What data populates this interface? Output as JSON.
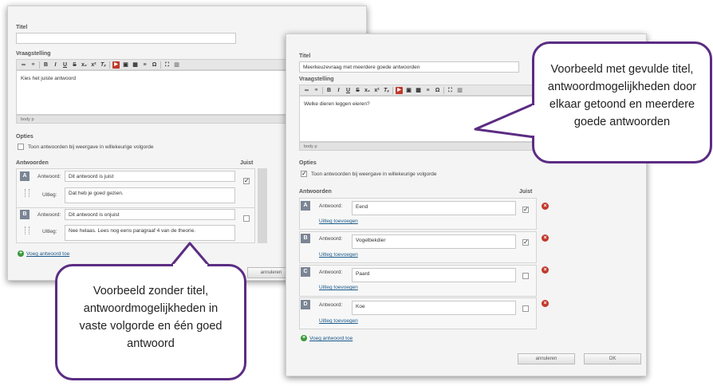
{
  "left": {
    "title_label": "Titel",
    "title_value": "",
    "question_label": "Vraagstelling",
    "question_text": "Kies het juiste antwoord",
    "editor_footer": "body  p",
    "options_label": "Opties",
    "shuffle_label": "Toon antwoorden bij weergave in willekeurige volgorde",
    "shuffle_checked": false,
    "answers_label": "Antwoorden",
    "correct_label": "Juist",
    "answer_field_label": "Antwoord:",
    "explanation_field_label": "Uitleg:",
    "answers": [
      {
        "letter": "A",
        "answer": "Dit antwoord is juist",
        "explanation": "Dat heb je goed gezien.",
        "correct": true
      },
      {
        "letter": "B",
        "answer": "Dit antwoord is onjuist",
        "explanation": "Nee helaas. Lees nog eens paragraaf 4 van de theorie.",
        "correct": false
      }
    ],
    "add_answer": "Voeg antwoord toe",
    "cancel": "annuleren"
  },
  "right": {
    "title_label": "Titel",
    "title_value": "Meerkeuzevraag met meerdere goede antwoorden",
    "question_label": "Vraagstelling",
    "question_text": "Welke dieren leggen eieren?",
    "editor_footer": "body  p",
    "options_label": "Opties",
    "shuffle_label": "Toon antwoorden bij weergave in willekeurige volgorde",
    "shuffle_checked": true,
    "answers_label": "Antwoorden",
    "correct_label": "Juist",
    "answer_field_label": "Antwoord:",
    "add_explanation": "Uitleg toevoegen",
    "answers": [
      {
        "letter": "A",
        "answer": "Eend",
        "correct": true
      },
      {
        "letter": "B",
        "answer": "Vogelbekdier",
        "correct": true
      },
      {
        "letter": "C",
        "answer": "Paard",
        "correct": false
      },
      {
        "letter": "D",
        "answer": "Koe",
        "correct": false
      }
    ],
    "add_answer": "Voeg antwoord toe",
    "cancel": "annuleren",
    "ok": "OK"
  },
  "callouts": {
    "left": "Voorbeeld zonder titel, antwoordmogelijkheden in vaste volgorde en één goed antwoord",
    "right": "Voorbeeld met gevulde titel, antwoordmogelijkheden door elkaar getoond en meerdere goede antwoorden"
  },
  "toolbar_icons": [
    "link-icon",
    "unlink-icon",
    "bold-icon",
    "italic-icon",
    "underline-icon",
    "strikethrough-icon",
    "subscript-icon",
    "superscript-icon",
    "remove-format-icon",
    "youtube-icon",
    "image-icon",
    "table-icon",
    "horizontal-rule-icon",
    "special-char-icon",
    "maximize-icon",
    "chart-icon"
  ]
}
